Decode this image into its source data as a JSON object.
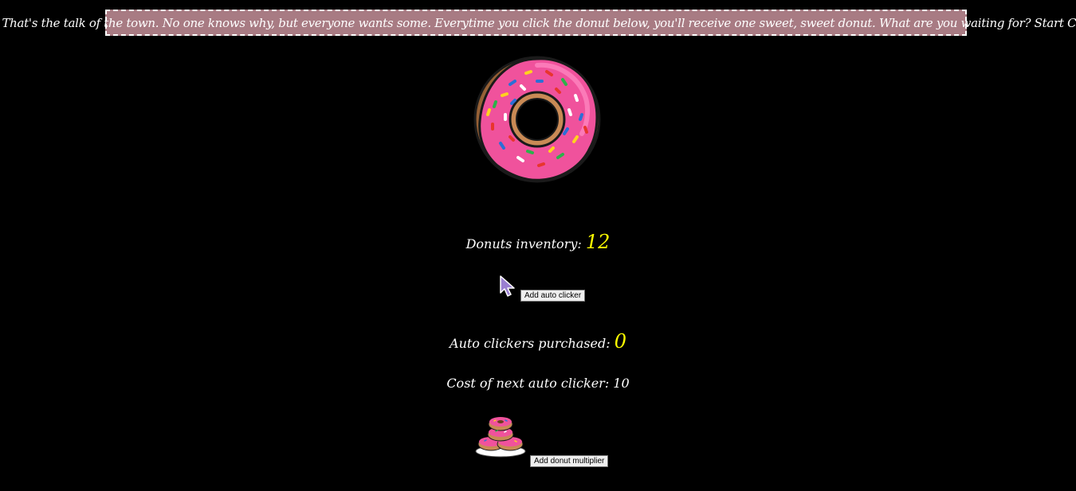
{
  "banner": {
    "text": "Donuts! That's the talk of the town. No one knows why, but everyone wants some. Everytime you click the donut below, you'll receive one sweet, sweet donut. What are you waiting for? Start Clicking!"
  },
  "inventory": {
    "label": "Donuts inventory:",
    "value": "12"
  },
  "auto_clicker": {
    "button_label": "Add auto clicker",
    "purchased_label": "Auto clickers purchased:",
    "purchased_value": "0",
    "cost_label": "Cost of next auto clicker: 10"
  },
  "multiplier": {
    "button_label": "Add donut multiplier"
  },
  "colors": {
    "banner_bg": "#a87b83",
    "icing": "#f0529c",
    "highlight_value": "#ffff00"
  },
  "icons": [
    "donut-icon",
    "pointer-cursor-icon",
    "donut-stack-icon"
  ]
}
